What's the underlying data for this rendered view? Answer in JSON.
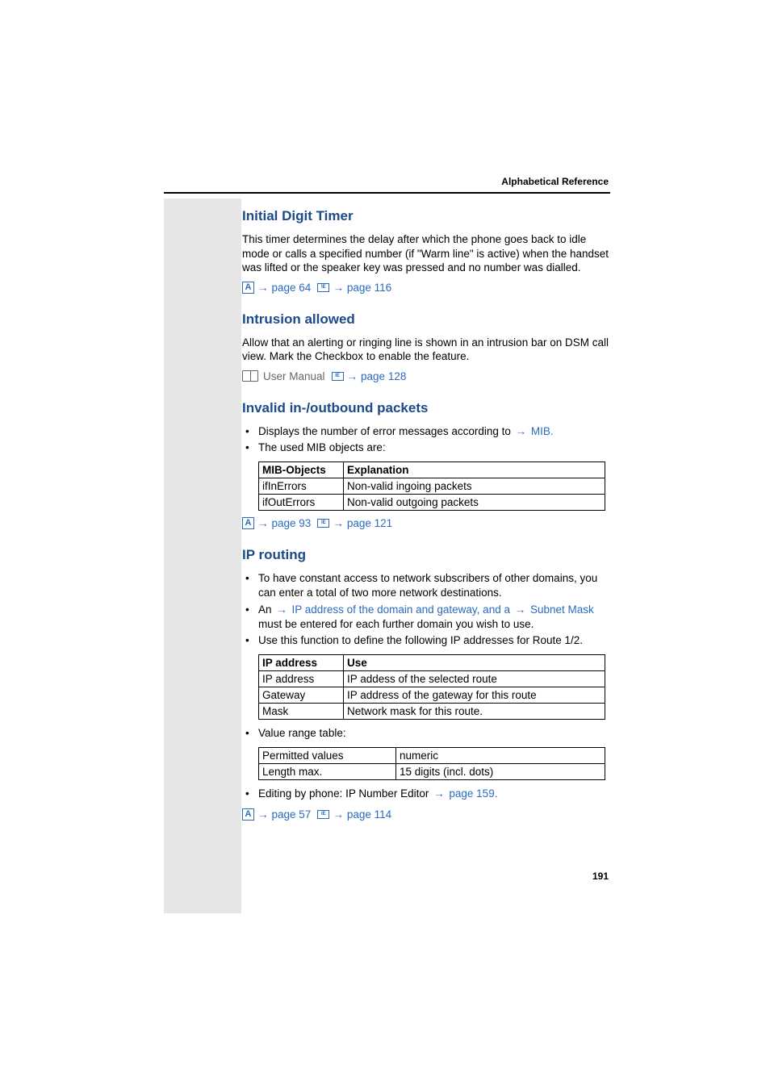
{
  "header": "Alphabetical Reference",
  "page_number": "191",
  "s1": {
    "title": "Initial Digit Timer",
    "para": "This timer determines the delay after which the phone goes back to idle mode or calls a specified number (if \"Warm line\" is active) when the handset was lifted or the speaker key was pressed and no number was dialled.",
    "ref1": "page 64",
    "ref2": "page 116"
  },
  "s2": {
    "title": "Intrusion allowed",
    "para": "Allow that an alerting or ringing line is shown in an intrusion bar on DSM call view. Mark the Checkbox to enable the feature.",
    "book": "User Manual",
    "ref": "page 128"
  },
  "s3": {
    "title": "Invalid in-/outbound packets",
    "b1a": "Displays the number of error messages according to ",
    "b1b": "MIB.",
    "b2": "The used MIB objects are:",
    "th1": "MIB-Objects",
    "th2": "Explanation",
    "r1c1": "ifInErrors",
    "r1c2": "Non-valid ingoing packets",
    "r2c1": "ifOutErrors",
    "r2c2": "Non-valid outgoing packets",
    "ref1": "page 93",
    "ref2": "page 121"
  },
  "s4": {
    "title": "IP routing",
    "b1": "To have constant access to network subscribers of other domains, you can enter a total of two more network destinations.",
    "b2a": "An ",
    "b2b": "IP address of the domain and gateway, and a ",
    "b2c": "Subnet Mask must be entered for each further domain you wish to use.",
    "b3": "Use this function to define the following IP addresses for Route 1/2.",
    "t1h1": "IP address",
    "t1h2": "Use",
    "t1r1c1": "IP address",
    "t1r1c2": "IP addess of the selected route",
    "t1r2c1": "Gateway",
    "t1r2c2": "IP address of the gateway for this route",
    "t1r3c1": "Mask",
    "t1r3c2": "Network mask for this route.",
    "b4": "Value range table:",
    "t2r1c1": "Permitted values",
    "t2r1c2": "numeric",
    "t2r2c1": "Length max.",
    "t2r2c2": "15 digits (incl. dots)",
    "b5a": "Editing by phone: IP Number Editor ",
    "b5b": "page 159.",
    "ref1": "page 57",
    "ref2": "page 114"
  },
  "arrow": "→"
}
